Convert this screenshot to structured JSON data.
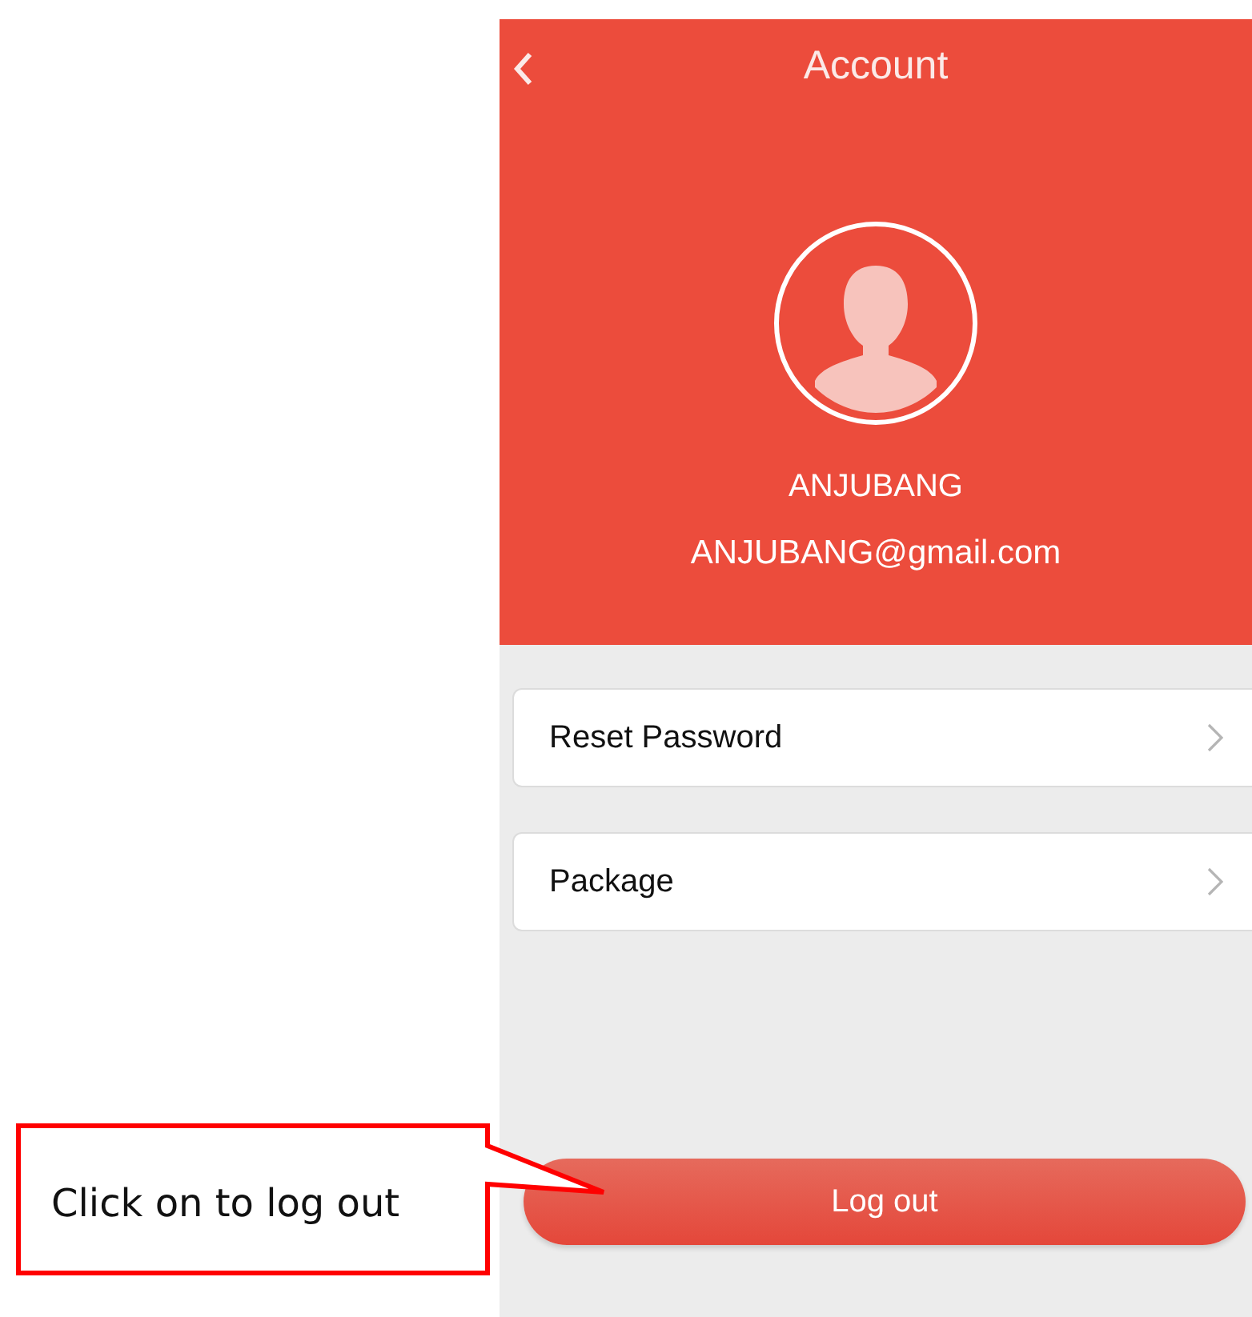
{
  "header": {
    "title": "Account"
  },
  "profile": {
    "name": "ANJUBANG",
    "email": "ANJUBANG@gmail.com"
  },
  "menu_items": [
    {
      "label": "Reset Password"
    },
    {
      "label": "Package"
    }
  ],
  "logout_button": {
    "label": "Log out"
  },
  "callout": {
    "text": "Click on to log out"
  }
}
